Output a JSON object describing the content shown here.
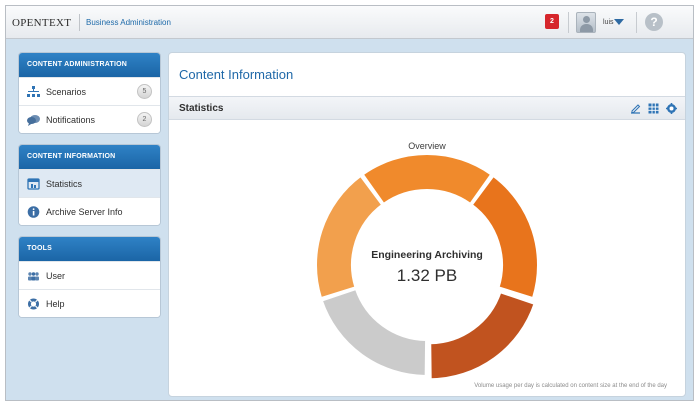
{
  "header": {
    "logo": "OPENTEXT",
    "app_name": "Business Administration",
    "notification_count": "2",
    "user_name": "luis",
    "help_label": "?"
  },
  "sidebar": {
    "groups": [
      {
        "title": "CONTENT ADMINISTRATION",
        "items": [
          {
            "label": "Scenarios",
            "count": "5",
            "icon": "scenarios-icon"
          },
          {
            "label": "Notifications",
            "count": "2",
            "icon": "notifications-icon"
          }
        ]
      },
      {
        "title": "CONTENT INFORMATION",
        "items": [
          {
            "label": "Statistics",
            "icon": "statistics-icon",
            "selected": true
          },
          {
            "label": "Archive Server Info",
            "icon": "info-icon"
          }
        ]
      },
      {
        "title": "TOOLS",
        "items": [
          {
            "label": "User",
            "icon": "users-icon"
          },
          {
            "label": "Help",
            "icon": "help-lifebuoy-icon"
          }
        ]
      }
    ]
  },
  "main": {
    "title": "Content Information",
    "section": "Statistics",
    "tools": [
      "edit-icon",
      "grid-icon",
      "settings-icon"
    ],
    "footnote": "Volume usage per day is calculated on content size at the end of the day"
  },
  "chart_data": {
    "type": "pie",
    "variant": "donut",
    "title": "Overview",
    "center_label": "Engineering Archiving",
    "center_value": "1.32 PB",
    "segments": [
      {
        "share": 0.2,
        "color": "#f08a2c"
      },
      {
        "share": 0.2,
        "color": "#e8741c"
      },
      {
        "share": 0.2,
        "color": "#c1531f",
        "exploded": true
      },
      {
        "share": 0.2,
        "color": "#cbcbcb"
      },
      {
        "share": 0.2,
        "color": "#f2a04d"
      }
    ]
  },
  "colors": {
    "accent": "#1f68a8",
    "nav_header": "#2473b6",
    "badge": "#d6262c"
  }
}
